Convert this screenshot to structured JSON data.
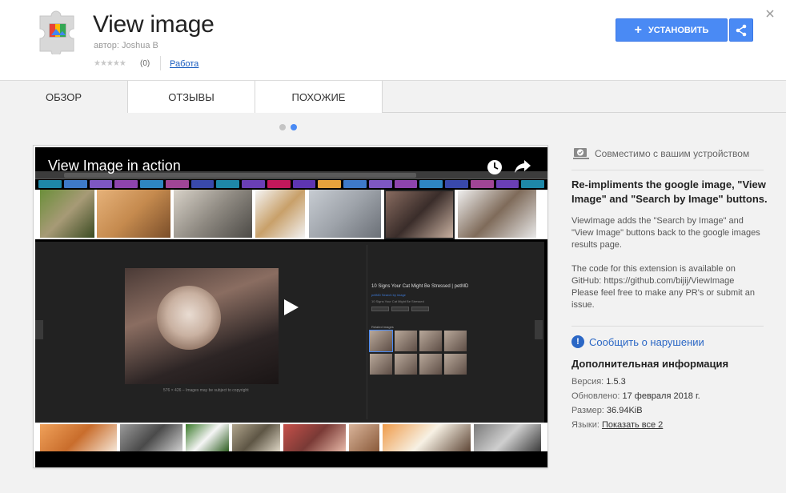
{
  "header": {
    "title": "View image",
    "author": "автор: Joshua B",
    "rating_stars": "★★★★★",
    "rating_count": "(0)",
    "category": "Работа",
    "install_label": "УСТАНОВИТЬ"
  },
  "tabs": [
    {
      "label": "ОБЗОР"
    },
    {
      "label": "ОТЗЫВЫ"
    },
    {
      "label": "ПОХОЖИЕ"
    }
  ],
  "video": {
    "title": "View Image in action",
    "panel_heading": "10 Signs Your Cat Might Be Stressed | petMD",
    "panel_sub": "petMD  Search by image",
    "panel_sub2": "10 Signs Your Cat Might Be Stressed",
    "panel_caption": "576 × 426 – Images may be subject to copyright",
    "related_label": "Related images"
  },
  "sidebar": {
    "compat": "Совместимо с вашим устройством",
    "summary": "Re-impliments the google image, \"View Image\" and \"Search by Image\" buttons.",
    "desc1": "ViewImage adds the \"Search by Image\" and \"View Image\" buttons back to the google images results page.",
    "desc2": "The code for this extension is available on GitHub: https://github.com/bijij/ViewImage Please feel free to make any PR's or submit an issue.",
    "report": "Сообщить о нарушении",
    "info_title": "Дополнительная информация",
    "version_label": "Версия: ",
    "version": "1.5.3",
    "updated_label": "Обновлено: ",
    "updated": "17 февраля 2018 г.",
    "size_label": "Размер: ",
    "size": "36.94KiB",
    "languages_label": "Языки: ",
    "languages": "Показать все 2"
  },
  "colors": {
    "accent": "#4a8af4",
    "link": "#2b67c5"
  },
  "icons": [
    "puzzle-icon",
    "plus-icon",
    "share-icon",
    "close-icon",
    "clock-icon",
    "share-arrow-icon",
    "play-icon",
    "device-check-icon",
    "info-icon"
  ]
}
